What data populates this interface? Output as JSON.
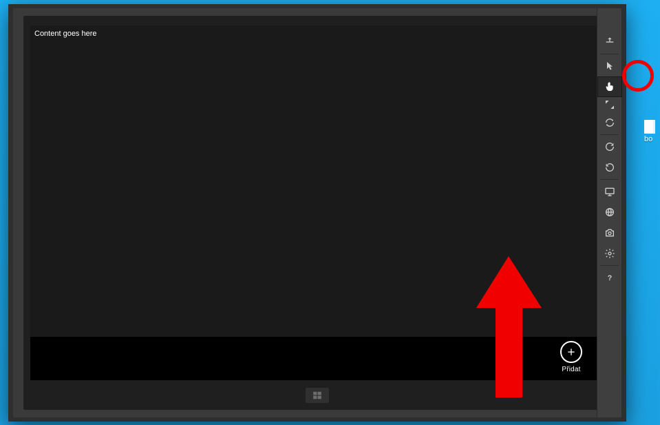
{
  "desktop": {
    "iconLabel": "bo"
  },
  "content": {
    "placeholder": "Content goes here"
  },
  "appBar": {
    "add": {
      "label": "Přidat"
    }
  },
  "toolbar": {
    "minimize": {
      "name": "minimize"
    },
    "items": [
      {
        "name": "always-on-top-icon"
      },
      {
        "name": "pointer-mouse-icon"
      },
      {
        "name": "touch-pointer-icon",
        "active": true
      },
      {
        "name": "pinch-zoom-icon"
      },
      {
        "name": "rotate-device-icon"
      },
      {
        "name": "rotate-clockwise-icon"
      },
      {
        "name": "rotate-counterclockwise-icon"
      },
      {
        "name": "display-resolution-icon"
      },
      {
        "name": "network-icon"
      },
      {
        "name": "screenshot-icon"
      },
      {
        "name": "settings-icon"
      },
      {
        "name": "help-icon"
      }
    ]
  },
  "annotation": {
    "circleTarget": "touch-pointer tool",
    "arrowColor": "#f10000"
  }
}
